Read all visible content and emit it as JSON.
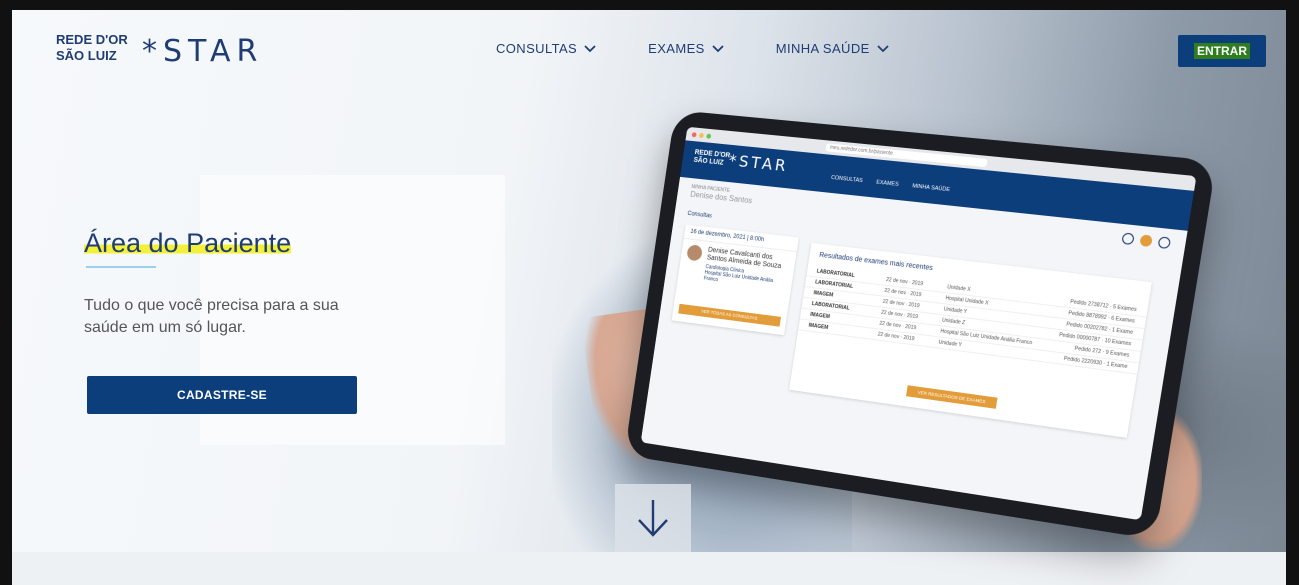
{
  "brand": {
    "logo_line1": "REDE D'OR",
    "logo_line2": "SÃO LUIZ",
    "product": "*STAR"
  },
  "nav": {
    "items": [
      {
        "label": "CONSULTAS"
      },
      {
        "label": "EXAMES"
      },
      {
        "label": "MINHA SAÚDE"
      }
    ],
    "login_label": "ENTRAR"
  },
  "hero": {
    "title": "Área do Paciente",
    "subtitle": "Tudo o que você precisa para a sua saúde em um só lugar.",
    "cta_label": "CADASTRE-SE"
  },
  "scroll_icon": "arrow-down-icon",
  "tablet": {
    "url": "meu.rededor.com.br/paciente",
    "menu": [
      "CONSULTAS",
      "EXAMES",
      "MINHA SAÚDE"
    ],
    "user_caption": "MINHA PACIENTE",
    "user_name": "Denise dos Santos",
    "consultas_heading": "Consultas",
    "consult_date": "16 de dezembro, 2021 | 8:00h",
    "doctor_name": "Denise Cavalcanti dos Santos Almeida de Souza",
    "doctor_specialty": "Cardiologia Clínica",
    "doctor_place": "Hospital São Luiz Unidade Anália Franco",
    "consult_button": "VER TODAS AS CONSULTAS",
    "results_heading": "Resultados de exames mais recentes",
    "results": [
      {
        "type": "LABORATORIAL",
        "date": "22 de nov · 2019",
        "place": "Unidade X",
        "order": "Pedido 2738712 · 5 Exames"
      },
      {
        "type": "LABORATORIAL",
        "date": "22 de nov · 2019",
        "place": "Hospital Unidade X",
        "order": "Pedido 8878992 · 6 Exames"
      },
      {
        "type": "IMAGEM",
        "date": "22 de nov · 2019",
        "place": "Unidade Y",
        "order": "Pedido 00202782 · 1 Exame"
      },
      {
        "type": "LABORATORIAL",
        "date": "22 de nov · 2019",
        "place": "Unidade Z",
        "order": "Pedido 00000787 · 10 Exames"
      },
      {
        "type": "IMAGEM",
        "date": "22 de nov · 2019",
        "place": "Hospital São Luiz Unidade Anália Franco",
        "order": "Pedido 272 · 9 Exames"
      },
      {
        "type": "IMAGEM",
        "date": "22 de nov · 2019",
        "place": "Unidade Y",
        "order": "Pedido 2220930 · 1 Exame"
      }
    ],
    "results_button": "VER RESULTADOS DE EXAMES"
  },
  "colors": {
    "brand_blue": "#0c3e7c",
    "title_blue": "#1f3c73",
    "highlight_yellow": "#f3f03a",
    "accent_orange": "#e39c3a"
  }
}
